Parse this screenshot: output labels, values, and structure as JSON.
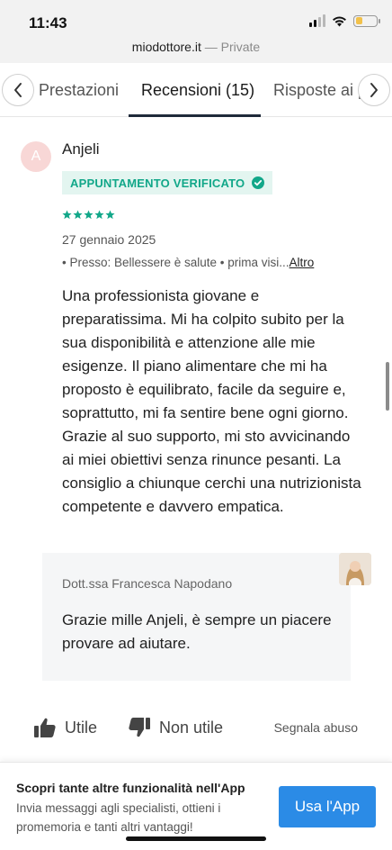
{
  "status_bar": {
    "time": "11:43"
  },
  "browser": {
    "domain": "miodottore.it",
    "separator": " — ",
    "mode": "Private"
  },
  "tabs": {
    "items": [
      {
        "label": "Prestazioni"
      },
      {
        "label": "Recensioni (15)"
      },
      {
        "label": "Risposte ai p"
      }
    ],
    "active_index": 1
  },
  "review": {
    "avatar_letter": "A",
    "reviewer_name": "Anjeli",
    "badge_label": "APPUNTAMENTO VERIFICATO",
    "rating": 5,
    "date": "27 gennaio 2025",
    "meta_text": "• Presso: Bellessere è salute • prima visi...",
    "more_link": "Altro",
    "text": "Una professionista giovane e preparatissima. Mi ha colpito subito per la sua disponibilità e attenzione alle mie esigenze. Il piano alimentare che mi ha proposto è equilibrato, facile da seguire e, soprattutto, mi fa sentire bene ogni giorno. Grazie al suo supporto, mi sto avvicinando ai miei obiettivi senza rinunce pesanti. La consiglio a chiunque cerchi una nutrizionista competente e davvero empatica."
  },
  "reply": {
    "author": "Dott.ssa Francesca Napodano",
    "text": "Grazie mille Anjeli, è sempre un piacere provare ad aiutare."
  },
  "actions": {
    "useful": "Utile",
    "not_useful": "Non utile",
    "report": "Segnala abuso"
  },
  "app_banner": {
    "title": "Scopri tante altre funzionalità nell'App",
    "subtitle": "Invia messaggi agli specialisti, ottieni i promemoria e tanti altri vantaggi!",
    "button": "Usa l'App"
  },
  "colors": {
    "accent_green": "#12a789",
    "badge_bg": "#e3f5f0",
    "app_button": "#2b8be6"
  }
}
